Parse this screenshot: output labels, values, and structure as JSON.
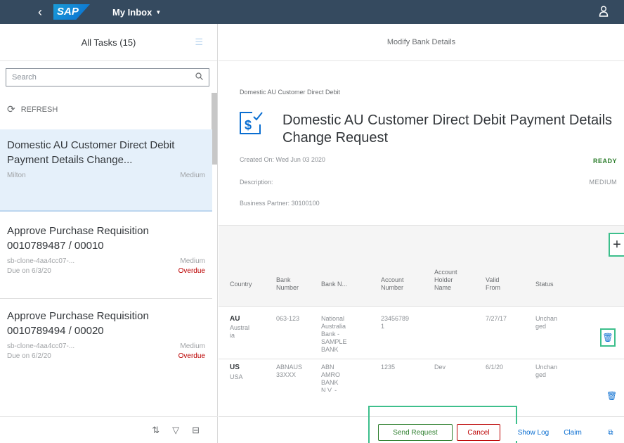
{
  "shell": {
    "back_icon": "chevron-left-icon",
    "logo": "SAP",
    "title": "My Inbox",
    "caret_icon": "triangle-down-icon",
    "user_icon": "person-icon"
  },
  "master": {
    "title": "All Tasks (15)",
    "sort_icon": "sort-icon",
    "search": {
      "placeholder": "Search",
      "icon": "magnifier-icon"
    },
    "refresh_label": "REFRESH",
    "items": [
      {
        "title": "Domestic AU Customer Direct Debit Payment Details Change...",
        "left": "Milton",
        "right": "Medium",
        "right2": ""
      },
      {
        "title": "Approve Purchase Requisition 0010789487 / 00010",
        "left": "sb-clone-4aa4cc07-...",
        "right": "Medium",
        "left2": "Due on 6/3/20",
        "right2": "Overdue"
      },
      {
        "title": "Approve Purchase Requisition 0010789494 / 00020",
        "left": "sb-clone-4aa4cc07-...",
        "right": "Medium",
        "left2": "Due on 6/2/20",
        "right2": "Overdue"
      }
    ],
    "footer_icons": [
      "sort-icon",
      "filter-icon",
      "group-icon"
    ]
  },
  "detail": {
    "title": "Modify Bank Details",
    "breadcrumb": "Domestic AU Customer Direct Debit",
    "object_title": "Domestic AU Customer Direct Debit Payment Details Change Request",
    "created_on": "Created On: Wed Jun 03 2020",
    "description": "Description:",
    "business_partner": "Business Partner: 30100100",
    "status": "READY",
    "priority": "MEDIUM",
    "table": {
      "columns": [
        "Country",
        "Bank Number",
        "Bank N...",
        "Account Number",
        "Account Holder Name",
        "Valid From",
        "Status"
      ],
      "rows": [
        {
          "country_code": "AU",
          "country": "Australia",
          "bank_number": "063-123",
          "bank_name": "National Australia Bank - SAMPLE BANK",
          "account": "23456789 1",
          "holder": "",
          "valid_from": "7/27/17",
          "status": "Unchanged"
        },
        {
          "country_code": "US",
          "country": "USA",
          "bank_number": "ABNAUS 33XXX",
          "bank_name": "ABN AMRO BANK N.V. - SAMPLE",
          "account": "1235",
          "holder": "Dev",
          "valid_from": "6/1/20",
          "status": "Unchanged"
        }
      ]
    }
  },
  "footer": {
    "send_request": "Send Request",
    "cancel": "Cancel",
    "show_log": "Show Log",
    "claim": "Claim"
  }
}
